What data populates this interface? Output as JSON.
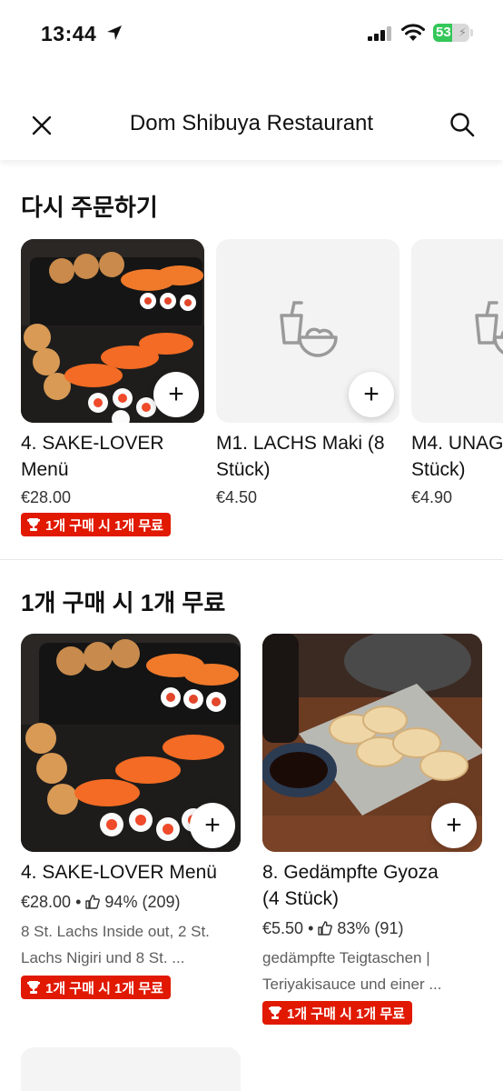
{
  "status_bar": {
    "time": "13:44",
    "battery": "53",
    "battery_level": 0.53
  },
  "header": {
    "title": "Dom Shibuya Restaurant"
  },
  "reorder": {
    "title": "다시 주문하기",
    "items": [
      {
        "name_line1": "4. SAKE-LOVER",
        "name_line2": "Menü",
        "price": "€28.00",
        "promo": "1개 구매 시 1개 무료"
      },
      {
        "name_line1": "M1. LACHS Maki (8",
        "name_line2": "Stück)",
        "price": "€4.50"
      },
      {
        "name_line1": "M4. UNAG",
        "name_line2": "Stück)",
        "price": "€4.90"
      }
    ]
  },
  "bogo": {
    "title": "1개 구매 시 1개 무료",
    "items": [
      {
        "name_line1": "4. SAKE-LOVER Menü",
        "price": "€28.00",
        "rating": "94% (209)",
        "desc_line1": "8 St. Lachs Inside out, 2 St.",
        "desc_line2": "Lachs Nigiri und 8 St. ...",
        "promo": "1개 구매 시 1개 무료"
      },
      {
        "name_line1": "8. Gedämpfte Gyoza",
        "name_line2": "(4 Stück)",
        "price": "€5.50",
        "rating": "83% (91)",
        "desc_line1": "gedämpfte Teigtaschen |",
        "desc_line2": "Teriyakisauce und einer ...",
        "promo": "1개 구매 시 1개 무료"
      }
    ]
  },
  "icons": {
    "location": "location-arrow-icon",
    "close": "close-icon",
    "search": "search-icon",
    "add": "plus-icon",
    "thumbs_up": "thumbs-up-icon",
    "trophy": "trophy-icon",
    "placeholder": "food-bowl-placeholder-icon"
  },
  "colors": {
    "promo": "#e11900",
    "battery": "#34c759"
  },
  "separator": "•",
  "add_symbol": "+"
}
